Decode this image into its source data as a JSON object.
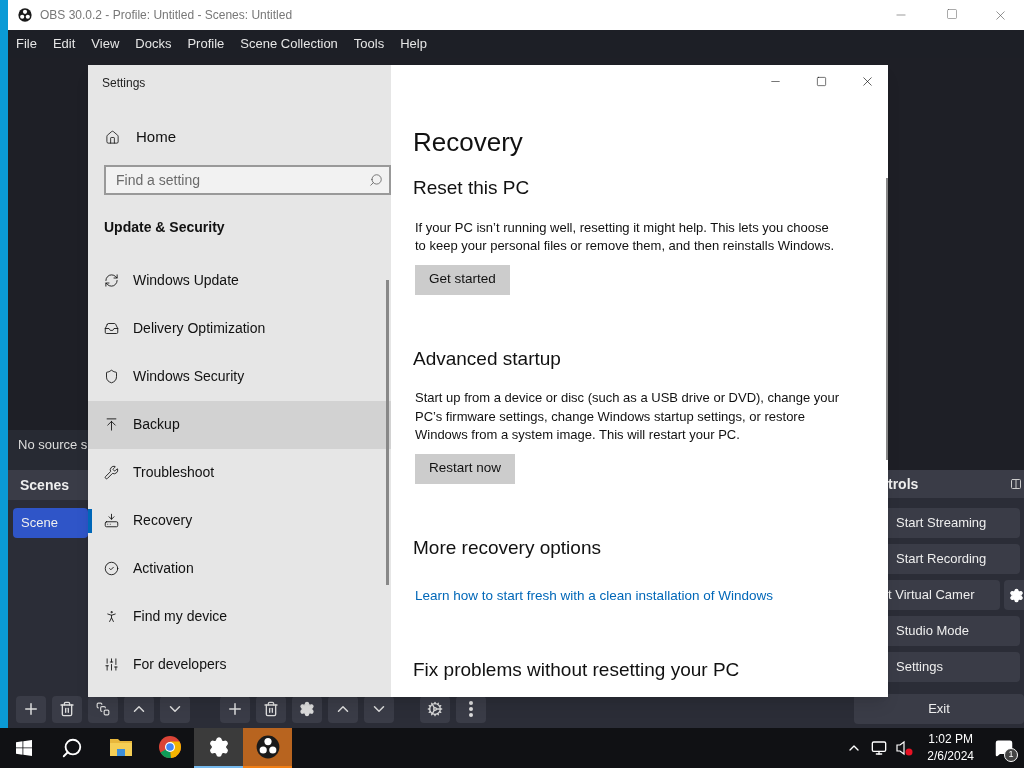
{
  "obs": {
    "title": "OBS 30.0.2 - Profile: Untitled - Scenes: Untitled",
    "menu": [
      "File",
      "Edit",
      "View",
      "Docks",
      "Profile",
      "Scene Collection",
      "Tools",
      "Help"
    ],
    "preview_status": "No source s",
    "scenes_dock": {
      "title": "Scenes",
      "items": [
        {
          "label": "Scene",
          "selected": true
        }
      ]
    },
    "controls_dock": {
      "title": "trols",
      "buttons": [
        {
          "label": "Start Streaming",
          "kind": "plain"
        },
        {
          "label": "Start Recording",
          "kind": "plain"
        },
        {
          "label": "t Virtual Camer",
          "kind": "with-gear"
        },
        {
          "label": "Studio Mode",
          "kind": "plain"
        },
        {
          "label": "Settings",
          "kind": "plain"
        }
      ]
    },
    "exit": "Exit"
  },
  "settings": {
    "title": "Settings",
    "home": "Home",
    "search": {
      "placeholder": "Find a setting"
    },
    "section": "Update & Security",
    "nav": [
      {
        "label": "Windows Update",
        "kind": "update",
        "selected": false,
        "hovered": false
      },
      {
        "label": "Delivery Optimization",
        "kind": "delivery",
        "selected": false,
        "hovered": false
      },
      {
        "label": "Windows Security",
        "kind": "security",
        "selected": false,
        "hovered": false
      },
      {
        "label": "Backup",
        "kind": "backup",
        "selected": false,
        "hovered": true
      },
      {
        "label": "Troubleshoot",
        "kind": "troubleshoot",
        "selected": false,
        "hovered": false
      },
      {
        "label": "Recovery",
        "kind": "recovery",
        "selected": true,
        "hovered": false
      },
      {
        "label": "Activation",
        "kind": "activation",
        "selected": false,
        "hovered": false
      },
      {
        "label": "Find my device",
        "kind": "find",
        "selected": false,
        "hovered": false
      },
      {
        "label": "For developers",
        "kind": "developers",
        "selected": false,
        "hovered": false
      }
    ],
    "page": {
      "title": "Recovery",
      "sections": [
        {
          "heading": "Reset this PC",
          "text": "If your PC isn’t running well, resetting it might help. This lets you choose to keep your personal files or remove them, and then reinstalls Windows.",
          "button": "Get started"
        },
        {
          "heading": "Advanced startup",
          "text": "Start up from a device or disc (such as a USB drive or DVD), change your PC’s firmware settings, change Windows startup settings, or restore Windows from a system image. This will restart your PC.",
          "button": "Restart now"
        },
        {
          "heading": "More recovery options",
          "link": "Learn how to start fresh with a clean installation of Windows"
        },
        {
          "heading": "Fix problems without resetting your PC"
        }
      ]
    }
  },
  "taskbar": {
    "apps": [
      {
        "kind": "explorer",
        "selected": false,
        "flashing": false
      },
      {
        "kind": "chrome",
        "selected": false,
        "flashing": false
      },
      {
        "kind": "settings",
        "selected": true,
        "flashing": false
      },
      {
        "kind": "obs",
        "selected": false,
        "flashing": true
      }
    ],
    "time": "1:02 PM",
    "date": "2/6/2024",
    "notifications": "1"
  }
}
